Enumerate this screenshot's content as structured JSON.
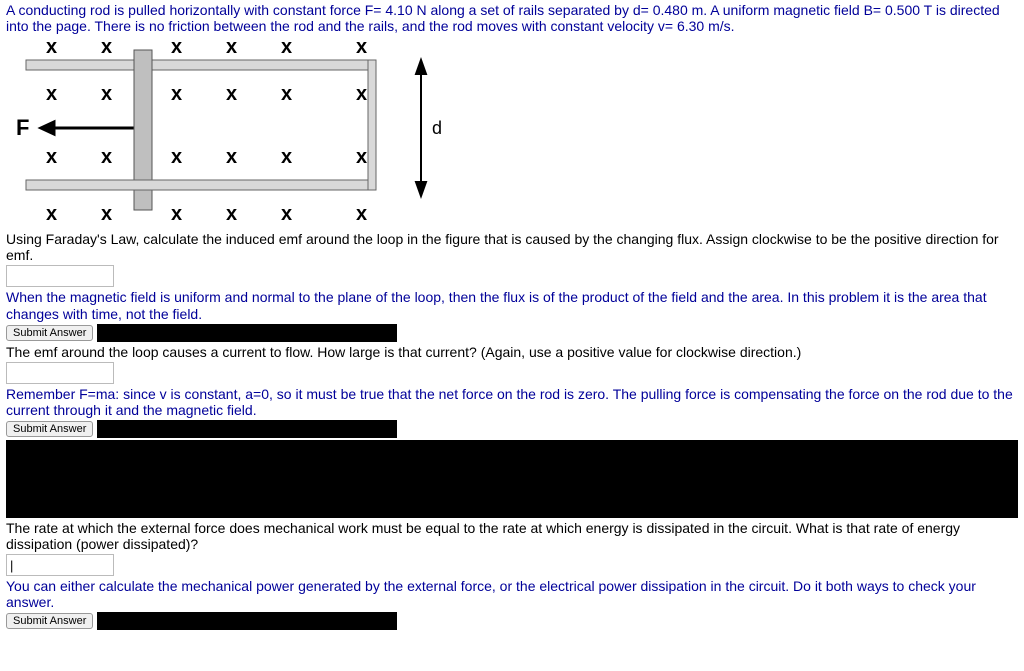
{
  "problem": {
    "statement": "A conducting rod is pulled horizontally with constant force F= 4.10 N along a set of rails separated by d= 0.480 m. A uniform magnetic field B= 0.500 T is directed into the page. There is no friction between the rod and the rails, and the rod moves with constant velocity v= 6.30 m/s."
  },
  "diagram": {
    "force_label": "F",
    "distance_label": "d",
    "x_symbol": "x"
  },
  "q1": {
    "text": "Using Faraday's Law, calculate the induced emf around the loop in the figure that is caused by the changing flux. Assign clockwise to be the positive direction for emf.",
    "hint": "When the magnetic field is uniform and normal to the plane of the loop, then the flux is of the product of the field and the area. In this problem it is the area that changes with time, not the field.",
    "submit": "Submit Answer"
  },
  "q2": {
    "text": "The emf around the loop causes a current to flow. How large is that current? (Again, use a positive value for clockwise direction.)",
    "hint": "Remember F=ma: since v is constant, a=0, so it must be true that the net force on the rod is zero. The pulling force is compensating the force on the rod due to the current through it and the magnetic field.",
    "submit": "Submit Answer"
  },
  "q3": {
    "text": "The rate at which the external force does mechanical work must be equal to the rate at which energy is dissipated in the circuit. What is that rate of energy dissipation (power dissipated)?",
    "hint": "You can either calculate the mechanical power generated by the external force, or the electrical power dissipation in the circuit. Do it both ways to check your answer.",
    "submit": "Submit Answer"
  }
}
